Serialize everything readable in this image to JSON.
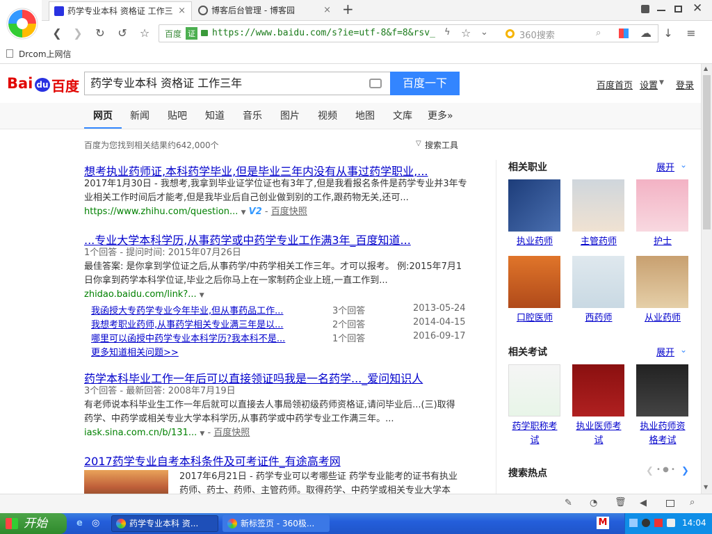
{
  "browser": {
    "tabs": [
      {
        "title": "药学专业本科 资格证 工作三",
        "close": "×",
        "active": true
      },
      {
        "title": "博客后台管理 - 博客园",
        "close": "×",
        "active": false
      }
    ],
    "new_tab": "+",
    "url_prefix": "百度",
    "url_badge": "证",
    "url": "https://www.baidu.com/s?ie=utf-8&f=8&rsv_",
    "search_placeholder": "360搜索",
    "bookmark": "Drcom上网信"
  },
  "baidu": {
    "logo_left": "Bai",
    "logo_du": "du",
    "logo_cn": "百度",
    "query": "药学专业本科 资格证 工作三年",
    "search_button": "百度一下",
    "top_links": [
      "百度首页",
      "设置",
      "登录"
    ],
    "tabs": [
      "网页",
      "新闻",
      "贴吧",
      "知道",
      "音乐",
      "图片",
      "视频",
      "地图",
      "文库",
      "更多»"
    ],
    "result_count": "百度为您找到相关结果约642,000个",
    "search_tools": "搜索工具"
  },
  "results": {
    "r1": {
      "title": "想考执业药师证,本科药学毕业,但是毕业三年内没有从事过药学职业,...",
      "line1": "2017年1月30日 - 我想考,我拿到毕业证学位证也有3年了,但是我看报名条件是药学专业并3年专",
      "line2": "业相关工作时间后才能考,但是我毕业后自己创业做到别的工作,跟药物无关,还可...",
      "url": "https://www.zhihu.com/question...",
      "v2": "V2",
      "snapshot": "百度快照"
    },
    "r2": {
      "title": "...专业大学本科学历,从事药学或中药学专业工作满3年_百度知道...",
      "meta": "1个回答 - 提问时间: 2015年07月26日",
      "line1": "最佳答案: 是你拿到学位证之后,从事药学/中药学相关工作三年。才可以报考。 例:2015年7月1",
      "line2": "日你拿到药学本科学位证,毕业之后你马上在一家制药企业上班,一直工作到...",
      "url": "zhidao.baidu.com/link?...",
      "subs": [
        {
          "q": "我函授大专药学专业今年毕业,但从事药品工作...",
          "a": "3个回答",
          "d": "2013-05-24"
        },
        {
          "q": "我想考职业药师,从事药学相关专业满三年是以...",
          "a": "2个回答",
          "d": "2014-04-15"
        },
        {
          "q": "哪里可以函授中药学专业本科学历?我本科不是...",
          "a": "1个回答",
          "d": "2016-09-17"
        }
      ],
      "more": "更多知道相关问题>>"
    },
    "r3": {
      "title": "药学本科毕业工作一年后可以直接领证吗我是一名药学..._爱问知识人",
      "meta": "3个回答 - 最新回答: 2008年7月19日",
      "line1": "有老师说本科毕业生工作一年后就可以直接去人事局领初级药师资格证,请问毕业后...(三)取得",
      "line2": "药学、中药学或相关专业大学本科学历,从事药学或中药学专业工作满三年。...",
      "url": "iask.sina.com.cn/b/131...",
      "snapshot": "百度快照"
    },
    "r4": {
      "title": "2017药学专业自考本科条件及可考证件_有途高考网",
      "line1": "2017年6月21日 - 药学专业可以考哪些证 药学专业能考的证书有执业",
      "line2": "药师、药士、药师、主管药师。取得药学、中药学或相关专业大学本"
    }
  },
  "right": {
    "jobs_title": "相关职业",
    "expand": "展开",
    "jobs": [
      "执业药师",
      "主管药师",
      "护士",
      "口腔医师",
      "西药师",
      "从业药师"
    ],
    "exams_title": "相关考试",
    "exams": [
      {
        "l1": "药学职称考",
        "l2": "试"
      },
      {
        "l1": "执业医师考",
        "l2": "试"
      },
      {
        "l1": "执业药师资",
        "l2": "格考试"
      }
    ],
    "hot_title": "搜索热点"
  },
  "taskbar": {
    "start": "开始",
    "tasks": [
      "药学专业本科 资...",
      "新标签页 - 360极..."
    ],
    "clock": "14:04"
  },
  "colors": {
    "accent": "#3385ff",
    "link": "#0000cc",
    "highlight": "#cc0000"
  }
}
